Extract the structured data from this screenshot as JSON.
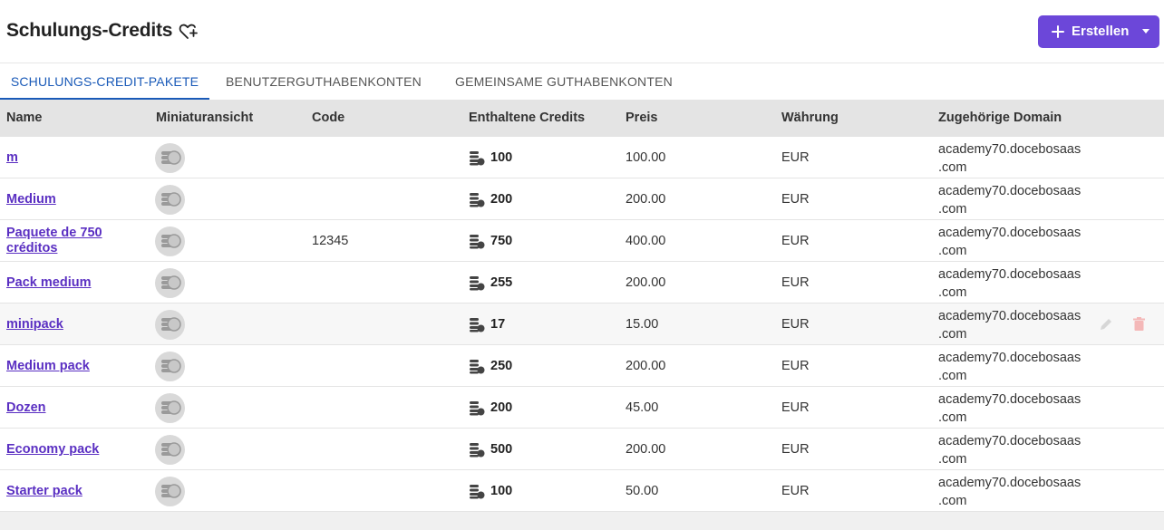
{
  "page": {
    "title": "Schulungs-Credits",
    "create_button": "Erstellen"
  },
  "tabs": [
    {
      "label": "SCHULUNGS-CREDIT-PAKETE",
      "active": true
    },
    {
      "label": "BENUTZERGUTHABENKONTEN",
      "active": false
    },
    {
      "label": "GEMEINSAME GUTHABENKONTEN",
      "active": false
    }
  ],
  "table": {
    "columns": [
      "Name",
      "Miniaturansicht",
      "Code",
      "Enthaltene Credits",
      "Preis",
      "Währung",
      "Zugehörige Domain"
    ],
    "rows": [
      {
        "name": "m",
        "code": "",
        "credits": "100",
        "price": "100.00",
        "currency": "EUR",
        "domain_line1": "academy70.docebosaas",
        "domain_line2": ".com"
      },
      {
        "name": "Medium",
        "code": "",
        "credits": "200",
        "price": "200.00",
        "currency": "EUR",
        "domain_line1": "academy70.docebosaas",
        "domain_line2": ".com"
      },
      {
        "name_line1": "Paquete de 750",
        "name_line2": "créditos",
        "code": "12345",
        "credits": "750",
        "price": "400.00",
        "currency": "EUR",
        "domain_line1": "academy70.docebosaas",
        "domain_line2": ".com"
      },
      {
        "name": "Pack medium",
        "code": "",
        "credits": "255",
        "price": "200.00",
        "currency": "EUR",
        "domain_line1": "academy70.docebosaas",
        "domain_line2": ".com"
      },
      {
        "name": "minipack",
        "code": "",
        "credits": "17",
        "price": "15.00",
        "currency": "EUR",
        "domain_line1": "academy70.docebosaas",
        "domain_line2": ".com"
      },
      {
        "name": "Medium pack",
        "code": "",
        "credits": "250",
        "price": "200.00",
        "currency": "EUR",
        "domain_line1": "academy70.docebosaas",
        "domain_line2": ".com"
      },
      {
        "name": "Dozen",
        "code": "",
        "credits": "200",
        "price": "45.00",
        "currency": "EUR",
        "domain_line1": "academy70.docebosaas",
        "domain_line2": ".com"
      },
      {
        "name": "Economy pack",
        "code": "",
        "credits": "500",
        "price": "200.00",
        "currency": "EUR",
        "domain_line1": "academy70.docebosaas",
        "domain_line2": ".com"
      },
      {
        "name": "Starter pack",
        "code": "",
        "credits": "100",
        "price": "50.00",
        "currency": "EUR",
        "domain_line1": "academy70.docebosaas",
        "domain_line2": ".com"
      }
    ]
  },
  "icons": {
    "favorite": "heart-plus-icon",
    "create": "plus-icon",
    "dropdown": "caret-down-icon",
    "thumbnail": "coin-stack-icon",
    "credits": "coins-icon",
    "edit": "pencil-icon",
    "delete": "trash-icon"
  },
  "colors": {
    "accent": "#6c47d9",
    "tab_active": "#1a5ab8",
    "link": "#5a2fc2",
    "header_bg": "#e4e4e4",
    "delete": "#f4b8b8"
  }
}
